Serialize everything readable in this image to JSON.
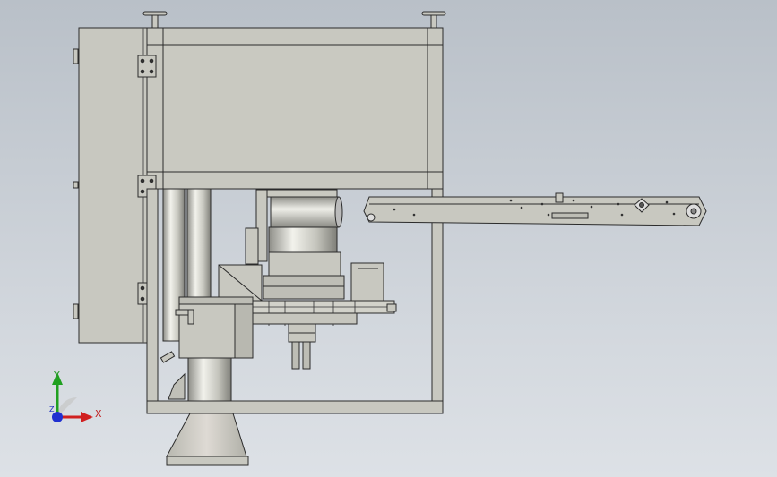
{
  "viewport": {
    "colors": {
      "background_top": "#b9c0c8",
      "background_bottom": "#dde1e6",
      "steel": "#c8c8c0",
      "steel_dark": "#a9a9a2",
      "edge": "#2b2b2b"
    }
  },
  "triad": {
    "x_label": "X",
    "y_label": "Y",
    "z_label": "Z",
    "colors": {
      "x": "#d02020",
      "y": "#20a020",
      "z": "#2030d0"
    }
  }
}
